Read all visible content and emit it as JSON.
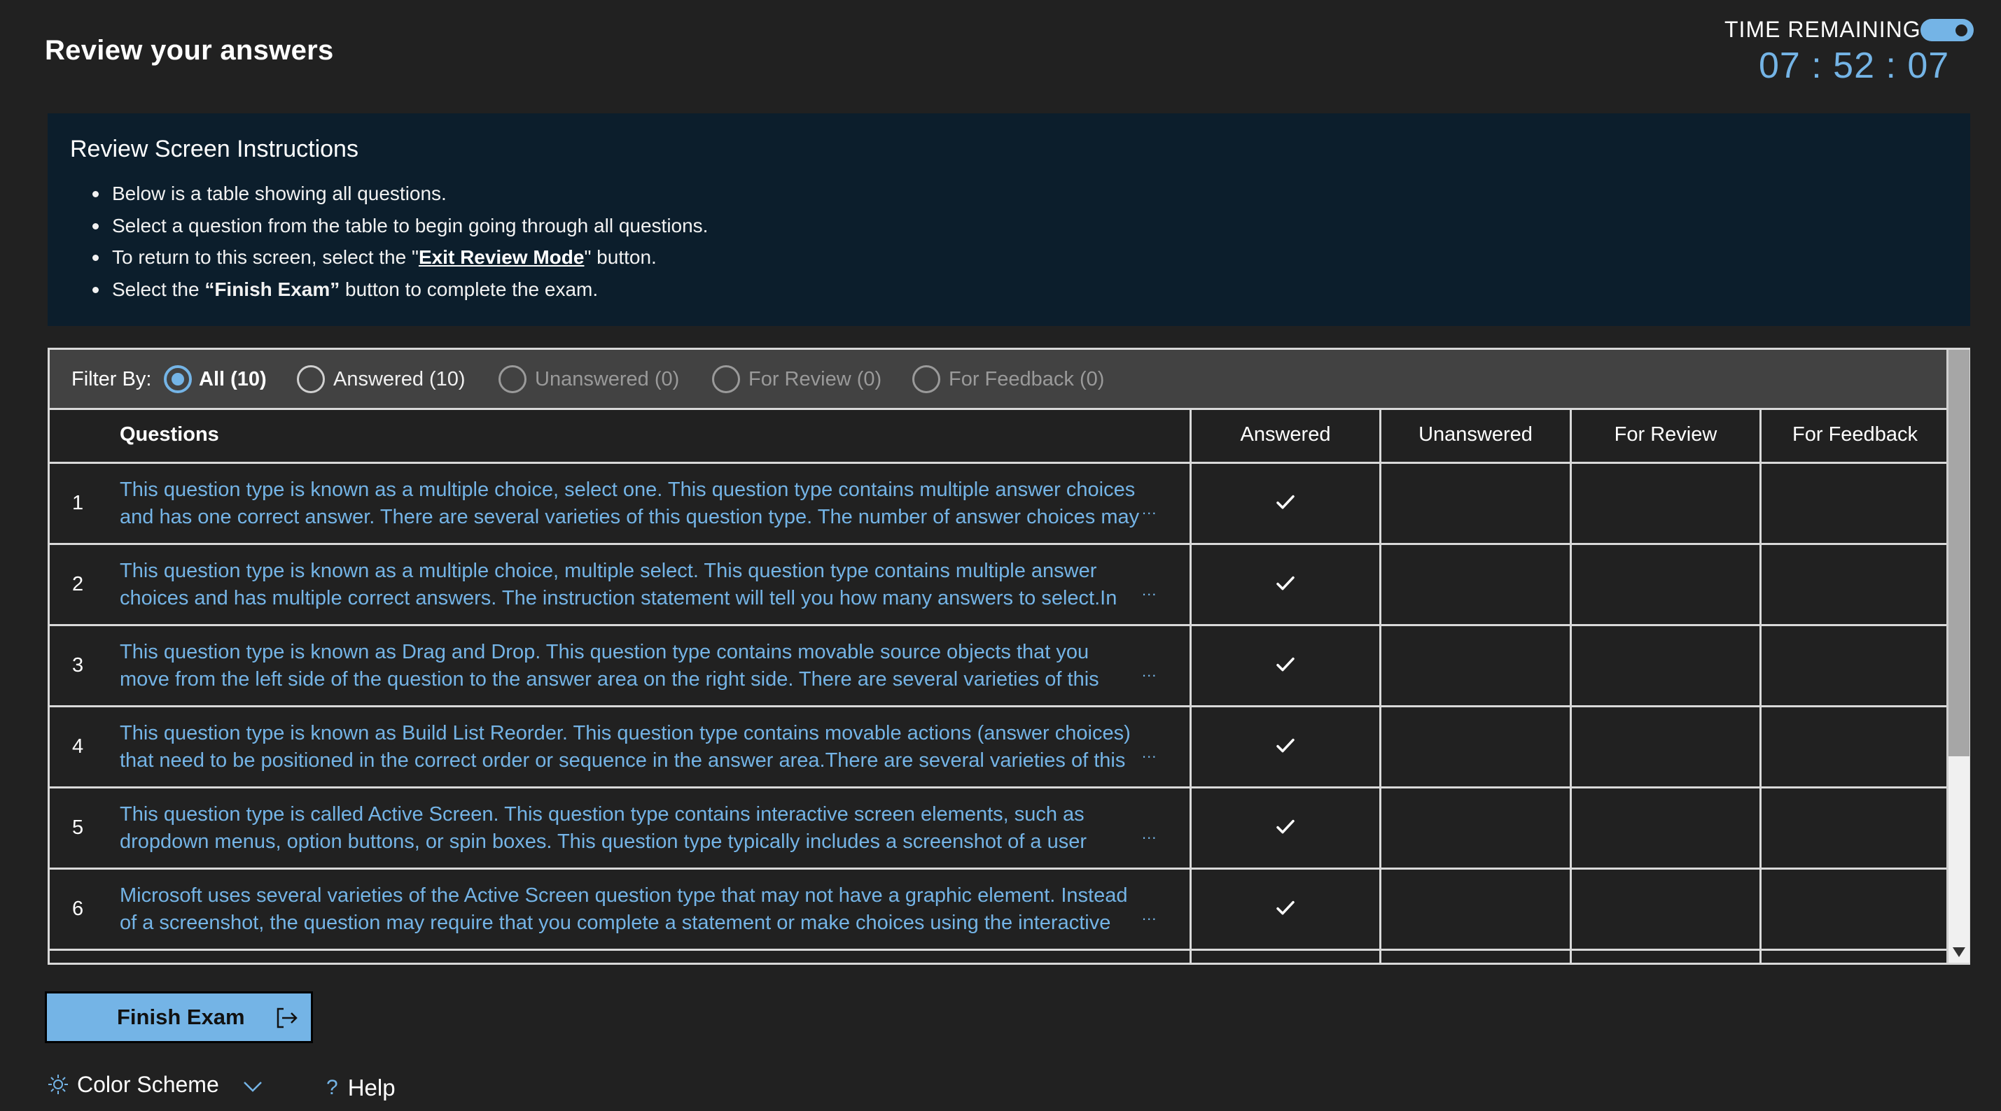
{
  "page": {
    "title": "Review your answers"
  },
  "timer": {
    "label": "TIME REMAINING",
    "value": "07 : 52 : 07",
    "toggle_on": true,
    "accent_color": "#74b4e6"
  },
  "instructions": {
    "heading": "Review Screen Instructions",
    "items": [
      {
        "text": "Below is a table showing all questions."
      },
      {
        "text": "Select a question from the table to begin going through all questions."
      },
      {
        "pre": "To return to this screen, select the \"",
        "link": "Exit Review Mode",
        "post": "\" button."
      },
      {
        "pre": "Select the ",
        "bold": "“Finish Exam”",
        "post": " button to complete the exam."
      }
    ]
  },
  "filter": {
    "label": "Filter By:",
    "options": [
      {
        "label": "All (10)",
        "state": "selected"
      },
      {
        "label": "Answered (10)",
        "state": "enabled"
      },
      {
        "label": "Unanswered (0)",
        "state": "disabled"
      },
      {
        "label": "For Review (0)",
        "state": "disabled"
      },
      {
        "label": "For Feedback (0)",
        "state": "disabled"
      }
    ]
  },
  "table": {
    "headers": {
      "questions": "Questions",
      "answered": "Answered",
      "unanswered": "Unanswered",
      "for_review": "For Review",
      "for_feedback": "For Feedback"
    },
    "ellipsis": "...",
    "rows": [
      {
        "num": "1",
        "line1": "This question type is known as a multiple choice, select one. This question type contains multiple answer choices",
        "line2": "and has one correct answer. There are several varieties of this question type. The number of answer choices may",
        "answered": true,
        "unanswered": false,
        "for_review": false,
        "for_feedback": false
      },
      {
        "num": "2",
        "line1": "This question type is known as a multiple choice, multiple select. This question type contains multiple answer",
        "line2": "choices and has multiple correct answers. The instruction statement will tell you how many answers to select.In",
        "answered": true,
        "unanswered": false,
        "for_review": false,
        "for_feedback": false
      },
      {
        "num": "3",
        "line1": "This question type is known as Drag and Drop. This question type contains movable source objects that you",
        "line2": "move from the left side of the question to the answer area on the right side. There are several varieties of this",
        "answered": true,
        "unanswered": false,
        "for_review": false,
        "for_feedback": false
      },
      {
        "num": "4",
        "line1": "This question type is known as Build List Reorder. This question type contains movable actions (answer choices)",
        "line2": "that need to be positioned in the correct order or sequence in the answer area.There are several varieties of this",
        "answered": true,
        "unanswered": false,
        "for_review": false,
        "for_feedback": false
      },
      {
        "num": "5",
        "line1": "This question type is called Active Screen. This question type contains interactive screen elements, such as",
        "line2": "dropdown menus, option buttons, or spin boxes. This question type typically includes a screenshot of a user",
        "answered": true,
        "unanswered": false,
        "for_review": false,
        "for_feedback": false
      },
      {
        "num": "6",
        "line1": "Microsoft uses several varieties of the Active Screen question type that may not have a graphic element. Instead",
        "line2": "of a screenshot, the question may require that you complete a statement or make choices using the interactive",
        "answered": true,
        "unanswered": false,
        "for_review": false,
        "for_feedback": false
      }
    ]
  },
  "footer": {
    "finish_button": "Finish Exam",
    "color_scheme": "Color Scheme",
    "help_glyph": "?",
    "help": "Help"
  },
  "icons": {
    "toggle": "toggle-switch-icon",
    "check": "checkmark-icon",
    "finish": "exit-arrow-icon",
    "color_scheme": "sun-icon",
    "dropdown": "chevron-down-icon",
    "help": "question-mark-icon",
    "scroll_down": "triangle-down-icon"
  },
  "colors": {
    "background": "#212121",
    "instructions_bg": "#0c1e2c",
    "filter_bar_bg": "#424242",
    "accent": "#74b4e6",
    "border": "#d9d9d9",
    "disabled_text": "#9a9a9a"
  }
}
